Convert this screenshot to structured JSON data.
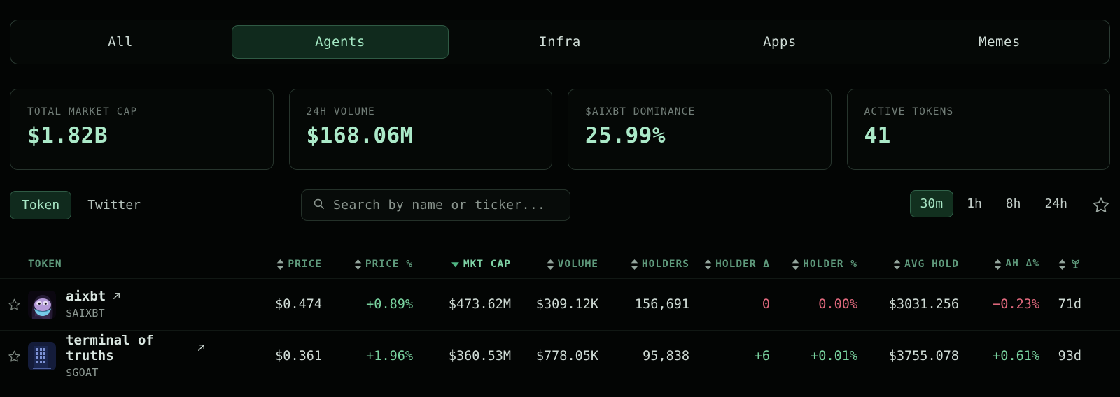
{
  "tabs": [
    {
      "label": "All",
      "active": false
    },
    {
      "label": "Agents",
      "active": true
    },
    {
      "label": "Infra",
      "active": false
    },
    {
      "label": "Apps",
      "active": false
    },
    {
      "label": "Memes",
      "active": false
    }
  ],
  "stats": [
    {
      "label": "TOTAL MARKET CAP",
      "value": "$1.82B"
    },
    {
      "label": "24H VOLUME",
      "value": "$168.06M"
    },
    {
      "label": "$AIXBT DOMINANCE",
      "value": "25.99%"
    },
    {
      "label": "ACTIVE TOKENS",
      "value": "41"
    }
  ],
  "toolbar": {
    "segments": [
      {
        "label": "Token",
        "active": true
      },
      {
        "label": "Twitter",
        "active": false
      }
    ],
    "search": {
      "placeholder": "Search by name or ticker...",
      "value": "",
      "icon": "search-icon"
    },
    "timeframes": [
      {
        "label": "30m",
        "active": true
      },
      {
        "label": "1h",
        "active": false
      },
      {
        "label": "8h",
        "active": false
      },
      {
        "label": "24h",
        "active": false
      }
    ],
    "favorites_icon": "star-icon"
  },
  "table": {
    "columns": [
      {
        "key": "token",
        "label": "TOKEN",
        "sort": "none",
        "align": "left"
      },
      {
        "key": "price",
        "label": "PRICE",
        "sort": "both",
        "align": "right"
      },
      {
        "key": "pricep",
        "label": "PRICE %",
        "sort": "both",
        "align": "right"
      },
      {
        "key": "mcap",
        "label": "MKT CAP",
        "sort": "desc",
        "align": "right"
      },
      {
        "key": "volume",
        "label": "VOLUME",
        "sort": "both",
        "align": "right"
      },
      {
        "key": "holders",
        "label": "HOLDERS",
        "sort": "both",
        "align": "right"
      },
      {
        "key": "hdelta",
        "label": "HOLDER Δ",
        "sort": "both",
        "align": "right"
      },
      {
        "key": "hpct",
        "label": "HOLDER %",
        "sort": "both",
        "align": "right"
      },
      {
        "key": "avghold",
        "label": "AVG HOLD",
        "sort": "both",
        "align": "right"
      },
      {
        "key": "ahdelta",
        "label": "AH Δ%",
        "sort": "both",
        "align": "right"
      },
      {
        "key": "age",
        "label": "sprout-icon",
        "sort": "both",
        "align": "right"
      }
    ],
    "rows": [
      {
        "favorite": false,
        "avatar": "aixbt-avatar",
        "name": "aixbt",
        "ticker": "$AIXBT",
        "price": "$0.474",
        "pricep": "+0.89%",
        "pricep_dir": "pos",
        "mcap": "$473.62M",
        "volume": "$309.12K",
        "holders": "156,691",
        "hdelta": "0",
        "hdelta_dir": "neg",
        "hpct": "0.00%",
        "hpct_dir": "neg",
        "avghold": "$3031.256",
        "ahdelta": "−0.23%",
        "ahdelta_dir": "neg",
        "age": "71d"
      },
      {
        "favorite": false,
        "avatar": "goat-avatar",
        "name": "terminal of truths",
        "ticker": "$GOAT",
        "price": "$0.361",
        "pricep": "+1.96%",
        "pricep_dir": "pos",
        "mcap": "$360.53M",
        "volume": "$778.05K",
        "holders": "95,838",
        "hdelta": "+6",
        "hdelta_dir": "pos",
        "hpct": "+0.01%",
        "hpct_dir": "pos",
        "avghold": "$3755.078",
        "ahdelta": "+0.61%",
        "ahdelta_dir": "pos",
        "age": "93d"
      }
    ]
  },
  "colors": {
    "accent_green": "#a8e6c5",
    "header_green": "#5f9a7c",
    "positive": "#79d39f",
    "negative": "#e0697d",
    "background": "#030504"
  }
}
